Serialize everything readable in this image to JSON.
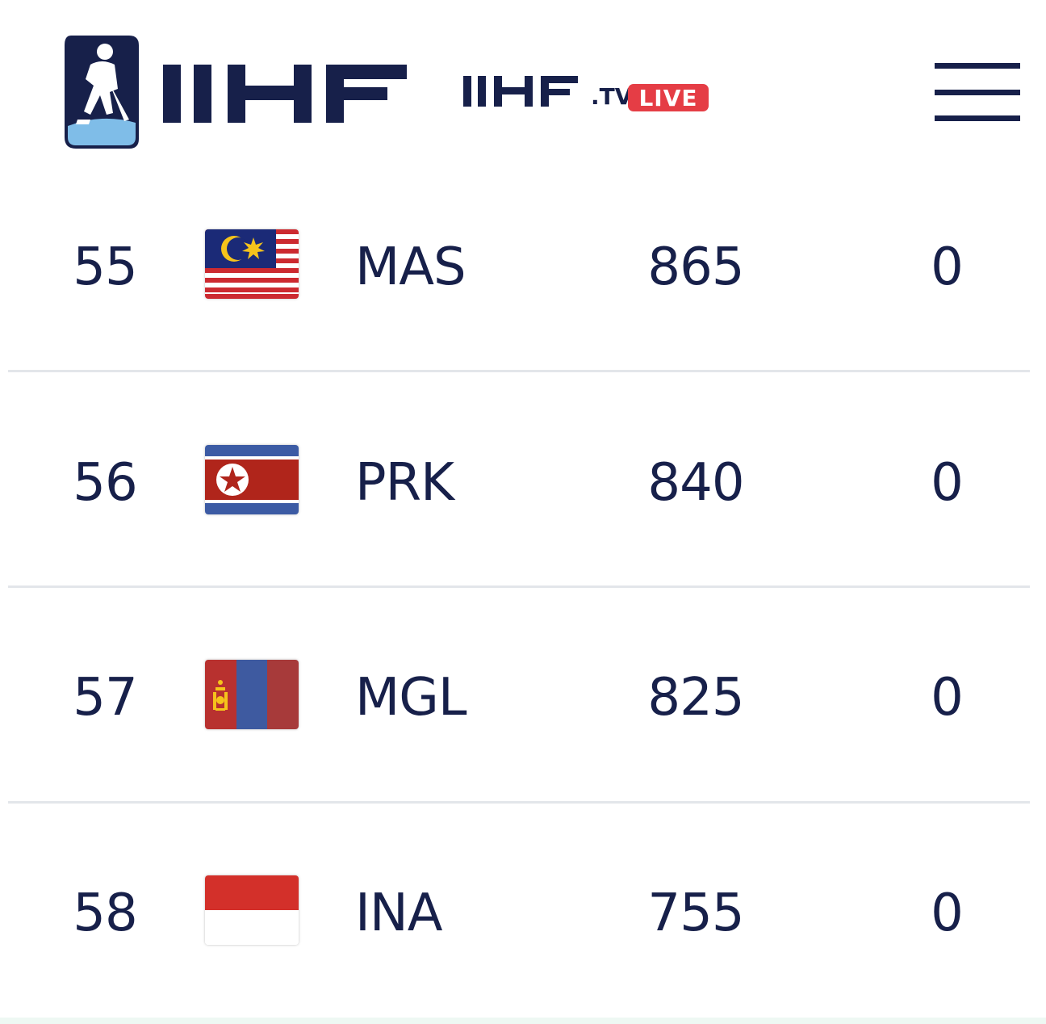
{
  "header": {
    "logo_icon": "ihf-hockey-player-logo",
    "wordmark": "IIHF",
    "tv_wordmark": "IIHF",
    "tv_suffix": ".TV",
    "live_badge": "LIVE",
    "menu_icon": "hamburger-menu-icon"
  },
  "rankings": [
    {
      "rank": "55",
      "team": "MAS",
      "points": "865",
      "extra": "0",
      "flag": "malaysia-flag"
    },
    {
      "rank": "56",
      "team": "PRK",
      "points": "840",
      "extra": "0",
      "flag": "north-korea-flag"
    },
    {
      "rank": "57",
      "team": "MGL",
      "points": "825",
      "extra": "0",
      "flag": "mongolia-flag"
    },
    {
      "rank": "58",
      "team": "INA",
      "points": "755",
      "extra": "0",
      "flag": "indonesia-flag"
    }
  ],
  "colors": {
    "brand_navy": "#17204a",
    "live_red": "#e53d45",
    "divider": "#e3e6ea"
  }
}
